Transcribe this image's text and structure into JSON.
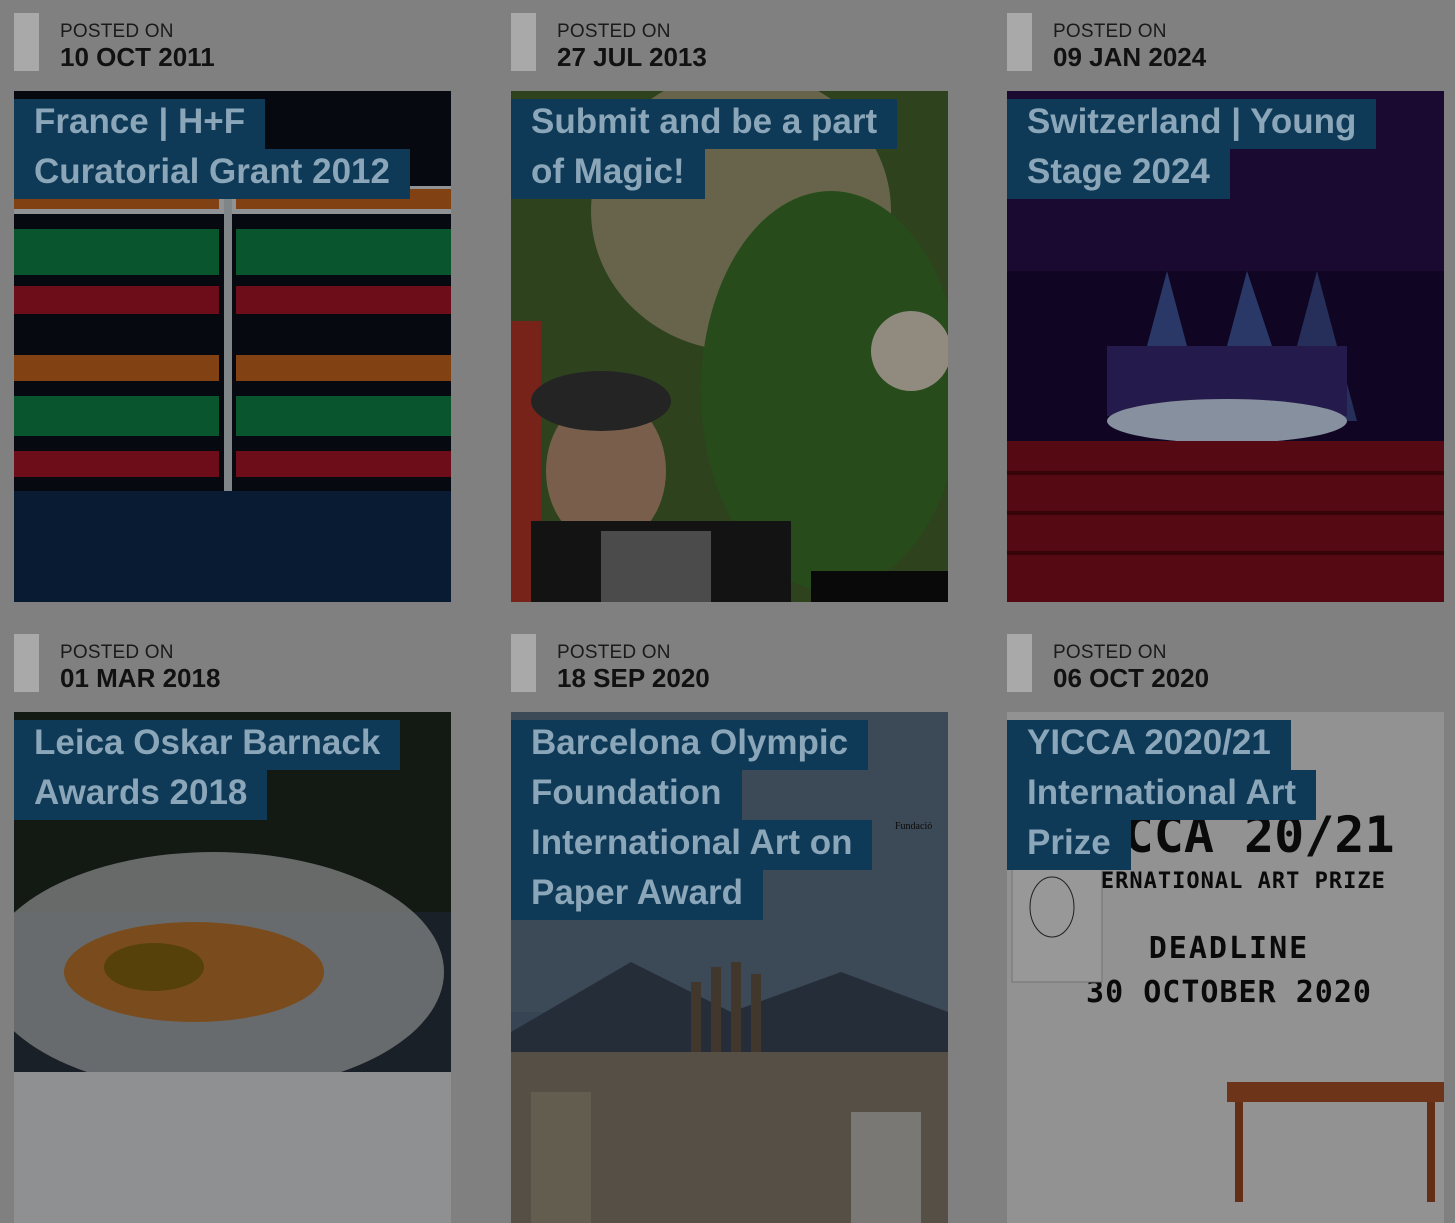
{
  "posts": [
    {
      "posted_label": "POSTED ON",
      "date": "10 OCT 2011",
      "title": "France | H+F Curatorial Grant 2012",
      "image_icon": "neon-stripes-image"
    },
    {
      "posted_label": "POSTED ON",
      "date": "27 JUL 2013",
      "title": "Submit and be a part of Magic!",
      "image_icon": "costume-performance-image"
    },
    {
      "posted_label": "POSTED ON",
      "date": "09 JAN 2024",
      "title": "Switzerland | Young Stage 2024",
      "image_icon": "circus-stage-image"
    },
    {
      "posted_label": "POSTED ON",
      "date": "01 MAR 2018",
      "title": "Leica Oskar Barnack Awards 2018",
      "image_icon": "snow-fire-image"
    },
    {
      "posted_label": "POSTED ON",
      "date": "18 SEP 2020",
      "title": "Barcelona Olympic Foundation International Art on Paper Award",
      "image_icon": "barcelona-city-image",
      "image_caption": "Fundació"
    },
    {
      "posted_label": "POSTED ON",
      "date": "06 OCT 2020",
      "title": "YICCA 2020/21 International Art Prize",
      "image_icon": "poster-image",
      "poster": {
        "line1": "YICCA 20/21",
        "line2": "INTERNATIONAL ART PRIZE",
        "line3": "DEADLINE",
        "line4": "30 OCTOBER 2020"
      }
    }
  ],
  "colors": {
    "overlay": "#808080",
    "title_bg": "#0e3a57",
    "title_text": "#8aa6b8",
    "date_bar": "#a9a9a9"
  }
}
